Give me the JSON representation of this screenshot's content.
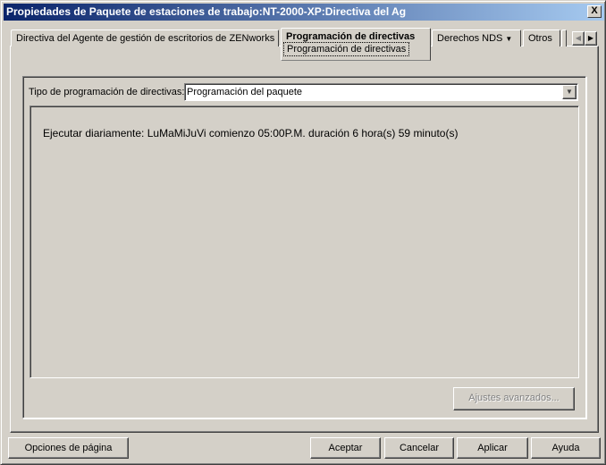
{
  "window": {
    "title": "Propiedades de Paquete de estaciones de trabajo:NT-2000-XP:Directiva del Ag",
    "close_label": "X"
  },
  "tabs": [
    {
      "label": "Directiva del Agente de gestión de escritorios de ZENworks"
    },
    {
      "label": "Programación de directivas",
      "subtab": "Programación de directivas",
      "active": true
    },
    {
      "label": "Derechos NDS",
      "dropdown": "▼"
    },
    {
      "label": "Otros"
    }
  ],
  "tab_scroll": {
    "left": "◀",
    "right": "▶"
  },
  "form": {
    "type_label": "Tipo de programación de directivas:",
    "type_value": "Programación del paquete",
    "dropdown_arrow": "▼"
  },
  "schedule_text": "Ejecutar diariamente: LuMaMiJuVi comienzo 05:00P.M. duración 6 hora(s) 59 minuto(s)",
  "advanced_button": "Ajustes avanzados...",
  "buttons": {
    "page_options": "Opciones de página",
    "ok": "Aceptar",
    "cancel": "Cancelar",
    "apply": "Aplicar",
    "help": "Ayuda"
  }
}
